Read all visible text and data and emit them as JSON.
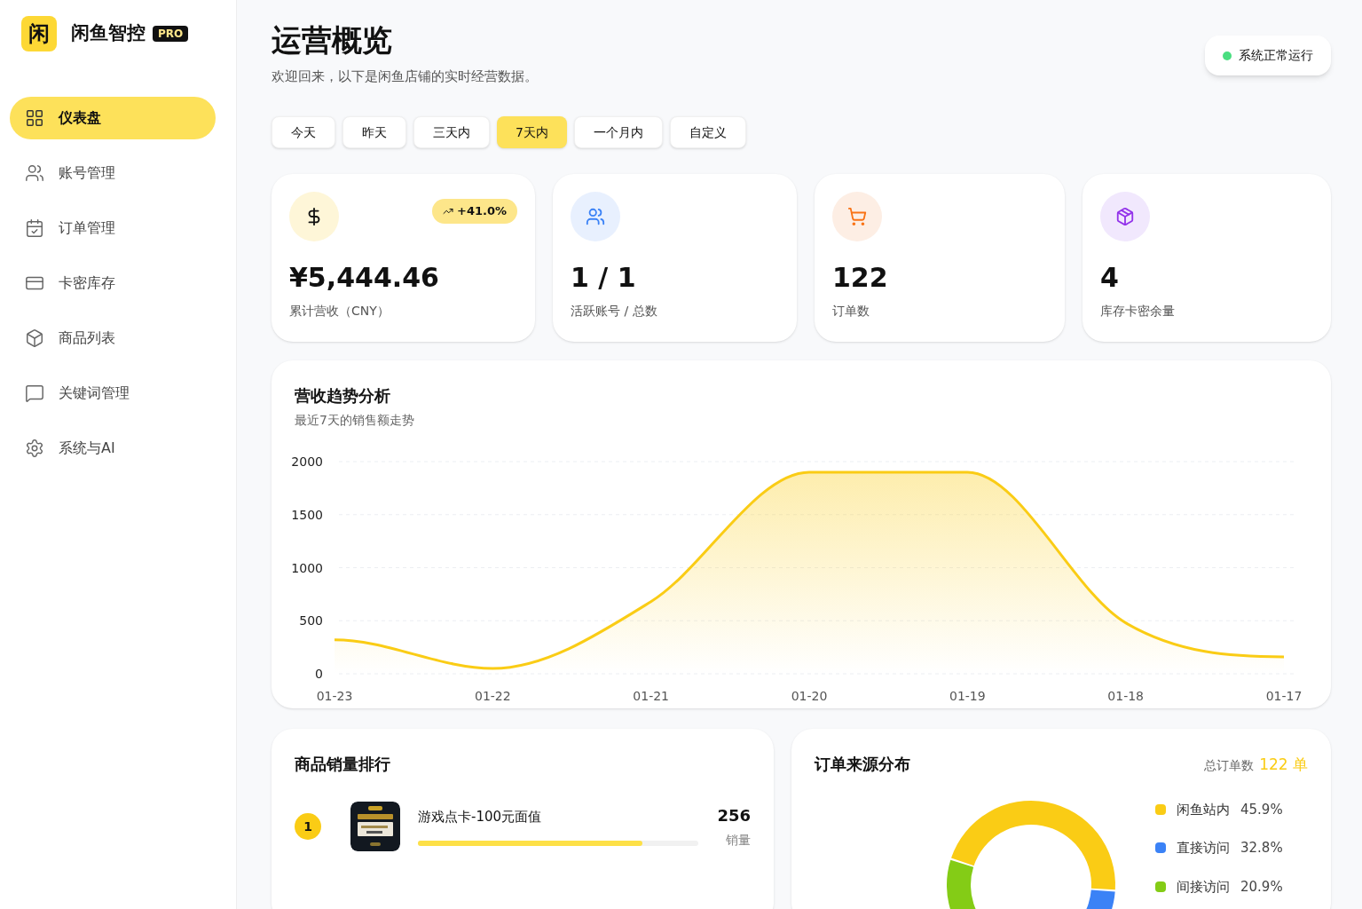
{
  "brand": {
    "logo_char": "闲",
    "name": "闲鱼智控",
    "badge": "PRO"
  },
  "sidebar": {
    "items": [
      {
        "label": "仪表盘",
        "selected": true
      },
      {
        "label": "账号管理",
        "selected": false
      },
      {
        "label": "订单管理",
        "selected": false
      },
      {
        "label": "卡密库存",
        "selected": false
      },
      {
        "label": "商品列表",
        "selected": false
      },
      {
        "label": "关键词管理",
        "selected": false
      },
      {
        "label": "系统与AI",
        "selected": false
      }
    ]
  },
  "header": {
    "title": "运营概览",
    "subtitle": "欢迎回来，以下是闲鱼店铺的实时经营数据。",
    "status": {
      "label": "系统正常运行",
      "color": "#4ade80"
    }
  },
  "ranges": [
    {
      "label": "今天",
      "selected": false
    },
    {
      "label": "昨天",
      "selected": false
    },
    {
      "label": "三天内",
      "selected": false
    },
    {
      "label": "7天内",
      "selected": true
    },
    {
      "label": "一个月内",
      "selected": false
    },
    {
      "label": "自定义",
      "selected": false
    }
  ],
  "stats": [
    {
      "value": "¥5,444.46",
      "label": "累计营收（CNY）",
      "trend": "+41.0%"
    },
    {
      "value": "1 / 1",
      "label": "活跃账号 / 总数"
    },
    {
      "value": "122",
      "label": "订单数"
    },
    {
      "value": "4",
      "label": "库存卡密余量"
    }
  ],
  "revenue": {
    "title": "营收趋势分析",
    "subtitle": "最近7天的销售额走势",
    "chart_data": {
      "type": "area",
      "categories": [
        "01-23",
        "01-22",
        "01-21",
        "01-20",
        "01-19",
        "01-18",
        "01-17"
      ],
      "series": [
        {
          "color": "#facc15",
          "values": [
            320,
            50,
            680,
            1900,
            1900,
            480,
            160
          ]
        }
      ],
      "ylim": [
        0,
        2000
      ],
      "yticks": [
        0,
        500,
        1000,
        1500,
        2000
      ],
      "grid": true
    }
  },
  "ranking": {
    "title": "商品销量排行",
    "items": [
      {
        "rank": "1",
        "name": "游戏点卡-100元面值",
        "count": "256",
        "count_label": "销量",
        "level": 0.8
      }
    ]
  },
  "sources": {
    "title": "订单来源分布",
    "total_label": "总订单数",
    "total": "122 单",
    "legend": [
      {
        "share": "45.9%",
        "color": "#facc15"
      },
      {
        "share": "32.8%",
        "color": "#3b82f6"
      },
      {
        "share": "20.9%",
        "color": "#84cc16"
      }
    ],
    "chart_data": {
      "type": "donut",
      "categories": [
        "闲鱼站内",
        "直接访问",
        "间接访问"
      ],
      "series": [
        {
          "values": [
            45.9,
            32.8,
            20.9
          ]
        }
      ]
    }
  }
}
